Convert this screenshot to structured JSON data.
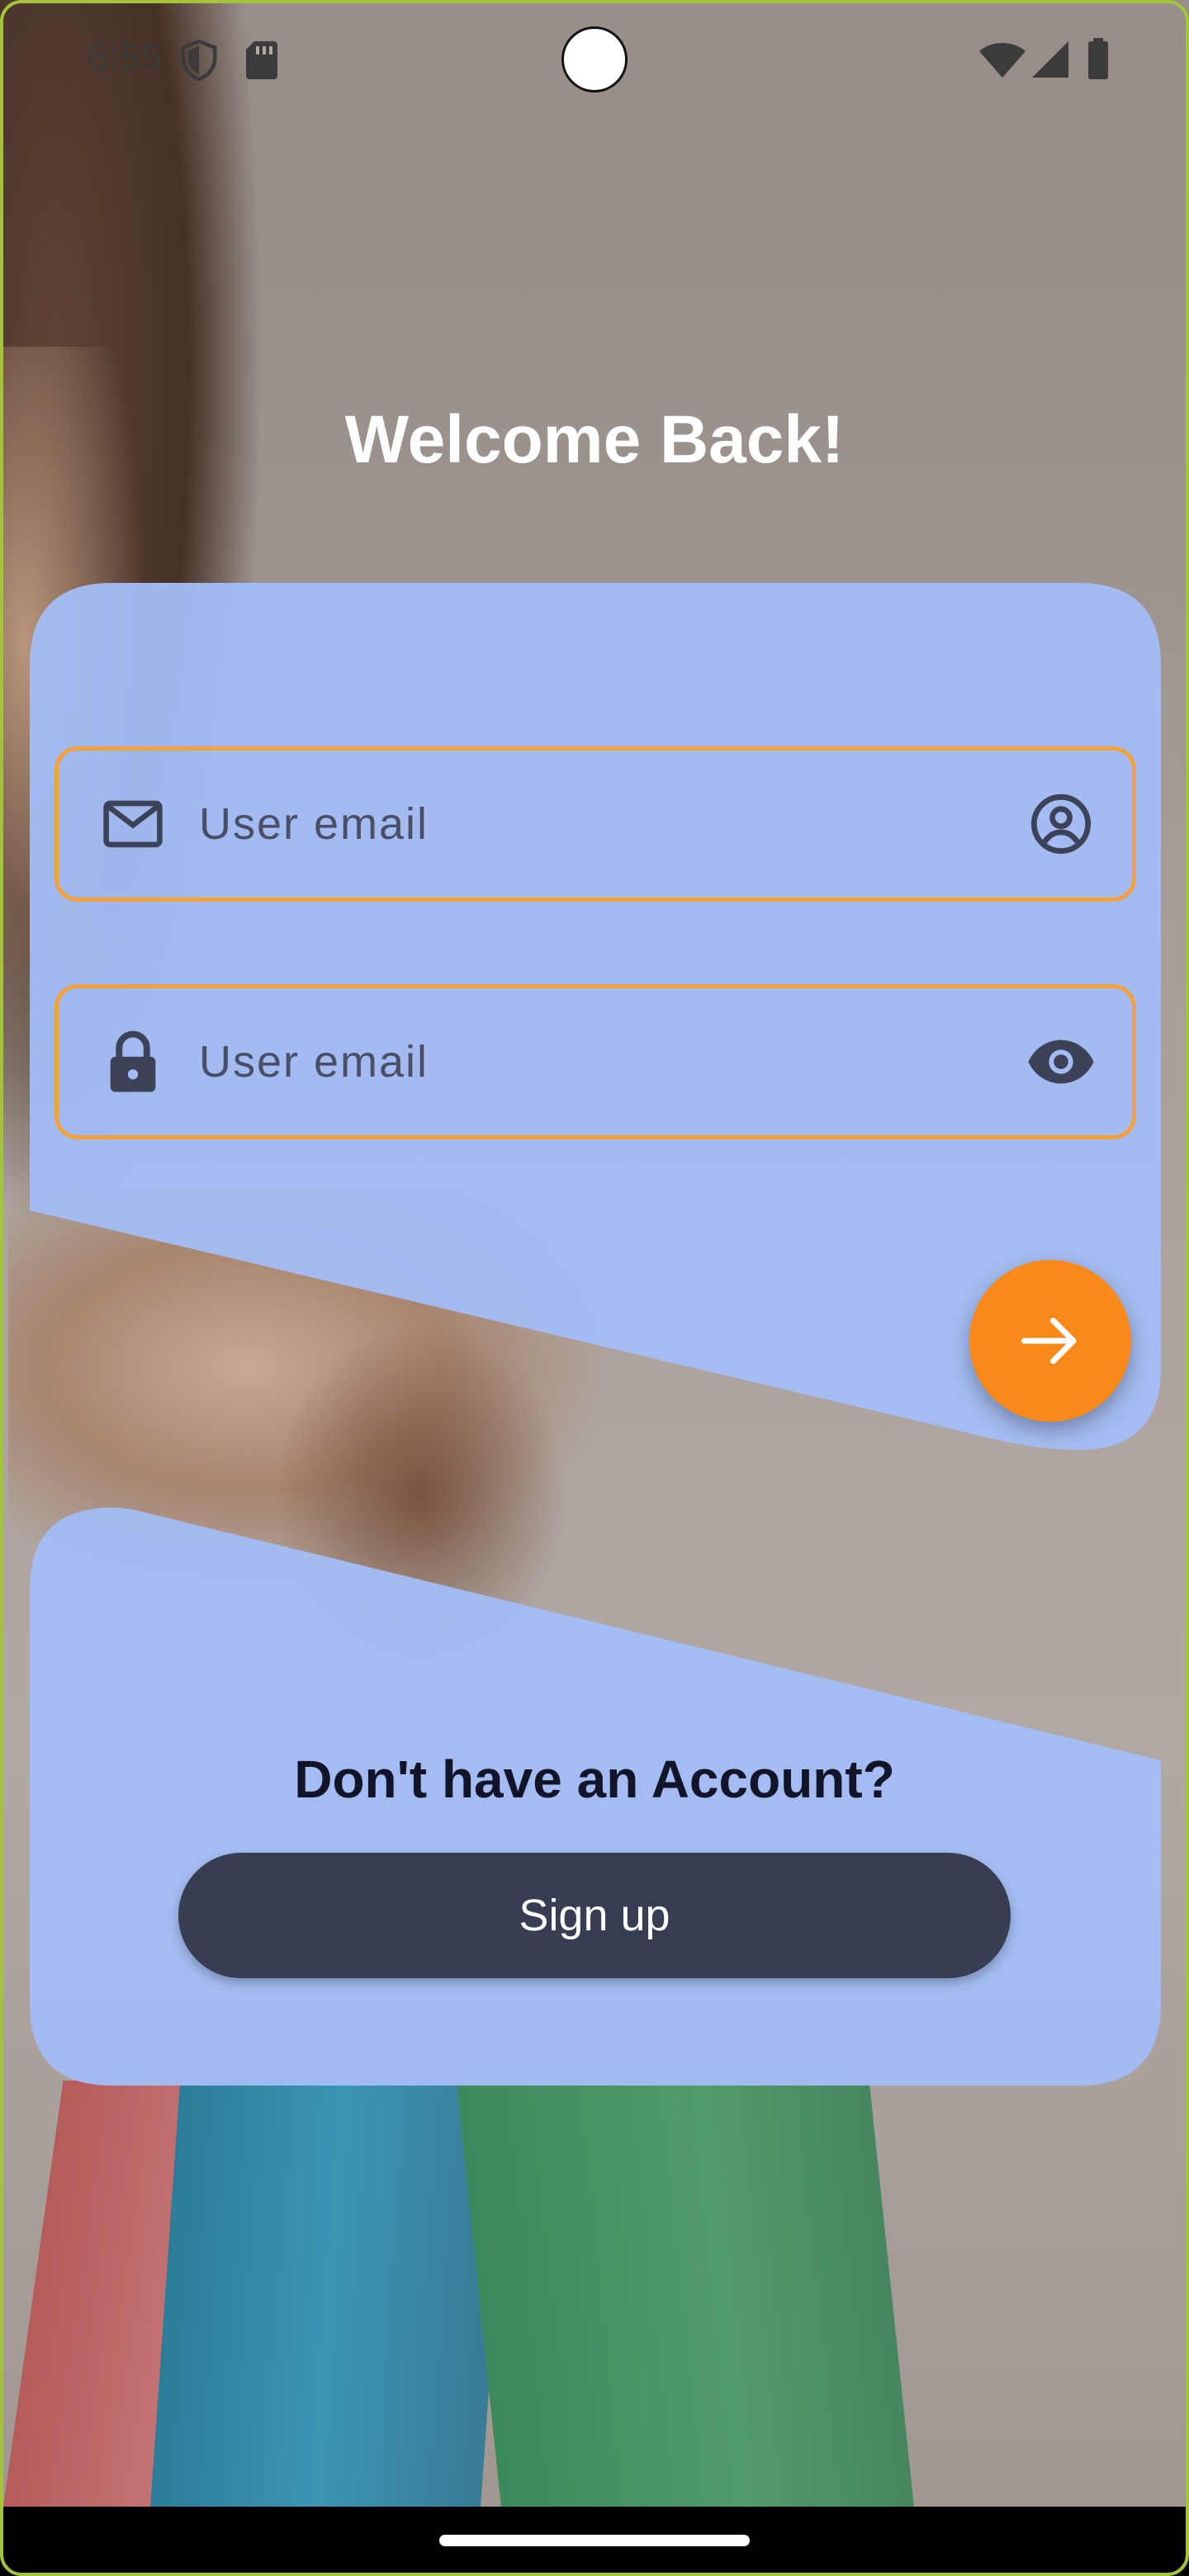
{
  "status_bar": {
    "time": "6:55",
    "icons": [
      "shield-icon",
      "sd-card-icon",
      "wifi-icon",
      "signal-icon",
      "battery-icon"
    ]
  },
  "header": {
    "title": "Welcome Back!"
  },
  "login_form": {
    "email_field": {
      "placeholder": "User email",
      "leading_icon": "mail-icon",
      "trailing_icon": "account-circle-icon"
    },
    "password_field": {
      "placeholder": "User email",
      "leading_icon": "lock-icon",
      "trailing_icon": "visibility-eye-icon"
    },
    "submit_icon": "arrow-right-icon"
  },
  "signup_section": {
    "prompt": "Don't have an Account?",
    "button_label": "Sign up"
  },
  "colors": {
    "card": "#a3bcf5",
    "field_border": "#f5a13b",
    "fab": "#f8891a",
    "signup_button": "#373d52",
    "title_text": "#ffffff"
  }
}
